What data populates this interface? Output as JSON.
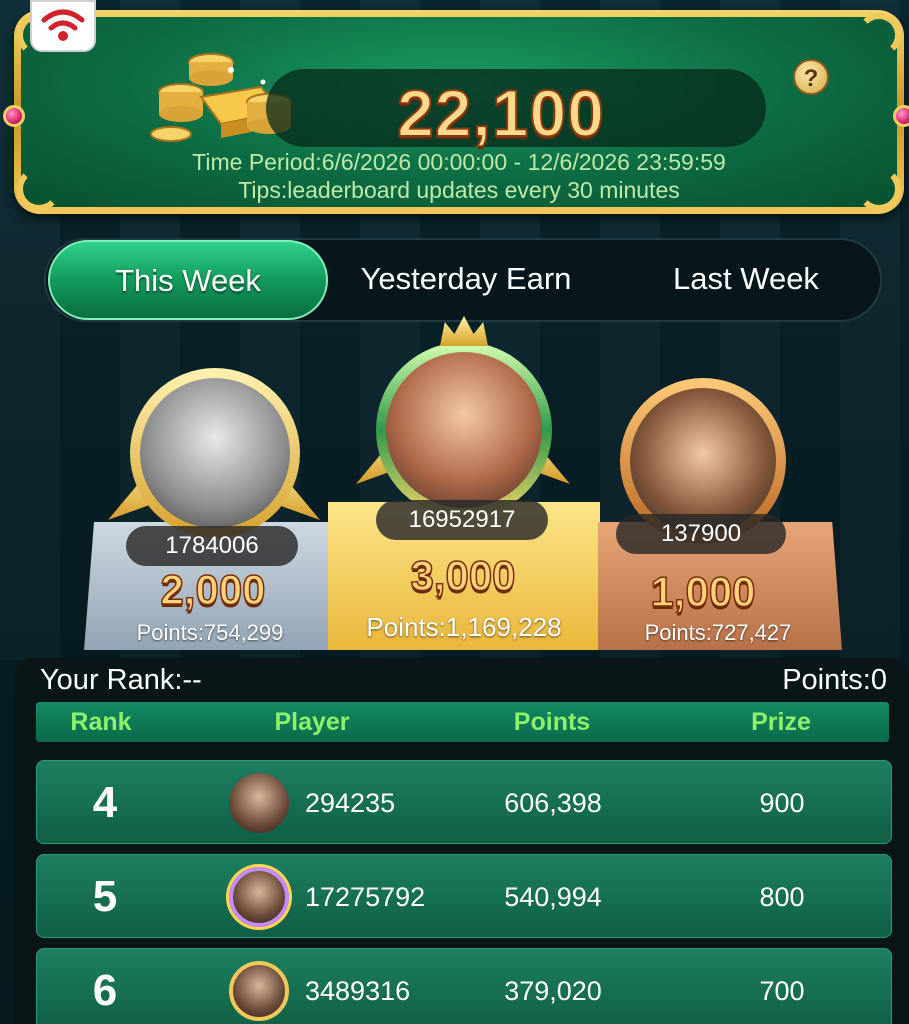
{
  "header": {
    "prize_total": "22,100",
    "time_period": "Time Period:6/6/2026 00:00:00 - 12/6/2026 23:59:59",
    "tips": "Tips:leaderboard updates every 30 minutes",
    "help_label": "?"
  },
  "tabs": [
    {
      "label": "This Week",
      "active": true
    },
    {
      "label": "Yesterday Earn",
      "active": false
    },
    {
      "label": "Last Week",
      "active": false
    }
  ],
  "podium": {
    "first": {
      "player_id": "16952917",
      "prize": "3,000",
      "points": "Points:1,169,228"
    },
    "second": {
      "player_id": "1784006",
      "prize": "2,000",
      "points": "Points:754,299"
    },
    "third": {
      "player_id": "137900",
      "prize": "1,000",
      "points": "Points:727,427"
    }
  },
  "my_rank": {
    "rank_text": "Your Rank:--",
    "points_text": "Points:0"
  },
  "table": {
    "headers": [
      "Rank",
      "Player",
      "Points",
      "Prize"
    ],
    "rows": [
      {
        "rank": "4",
        "player_id": "294235",
        "points": "606,398",
        "prize": "900"
      },
      {
        "rank": "5",
        "player_id": "17275792",
        "points": "540,994",
        "prize": "800"
      },
      {
        "rank": "6",
        "player_id": "3489316",
        "points": "379,020",
        "prize": "700"
      }
    ]
  },
  "colors": {
    "accent_green": "#139a5d",
    "header_text_green": "#8df26a",
    "gold": "#f0c95a"
  }
}
